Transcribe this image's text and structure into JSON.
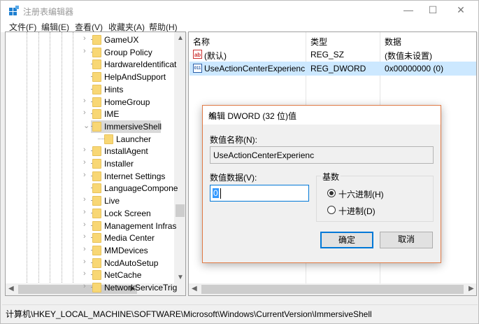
{
  "window": {
    "title": "注册表编辑器",
    "minimize": "—",
    "maximize": "☐",
    "close": "✕"
  },
  "menu": [
    "文件(F)",
    "编辑(E)",
    "查看(V)",
    "收藏夹(A)",
    "帮助(H)"
  ],
  "tree": [
    {
      "label": "GameUX",
      "expander": "›"
    },
    {
      "label": "Group Policy",
      "expander": "›"
    },
    {
      "label": "HardwareIdentificat",
      "expander": ""
    },
    {
      "label": "HelpAndSupport",
      "expander": ""
    },
    {
      "label": "Hints",
      "expander": ""
    },
    {
      "label": "HomeGroup",
      "expander": "›"
    },
    {
      "label": "IME",
      "expander": "›"
    },
    {
      "label": "ImmersiveShell",
      "expander": "⌄",
      "selected": true
    },
    {
      "label": "Launcher",
      "expander": "",
      "child": true
    },
    {
      "label": "InstallAgent",
      "expander": "›"
    },
    {
      "label": "Installer",
      "expander": "›"
    },
    {
      "label": "Internet Settings",
      "expander": "›"
    },
    {
      "label": "LanguageCompone",
      "expander": ""
    },
    {
      "label": "Live",
      "expander": "›"
    },
    {
      "label": "Lock Screen",
      "expander": "›"
    },
    {
      "label": "Management Infras",
      "expander": "›"
    },
    {
      "label": "Media Center",
      "expander": "›"
    },
    {
      "label": "MMDevices",
      "expander": "›"
    },
    {
      "label": "NcdAutoSetup",
      "expander": "›"
    },
    {
      "label": "NetCache",
      "expander": "›"
    },
    {
      "label": "NetworkServiceTrig",
      "expander": "›"
    }
  ],
  "values": {
    "headers": [
      "名称",
      "类型",
      "数据"
    ],
    "rows": [
      {
        "icon": "ab",
        "name": "(默认)",
        "type": "REG_SZ",
        "data": "(数值未设置)"
      },
      {
        "icon": "011",
        "name": "UseActionCenterExperienc",
        "type": "REG_DWORD",
        "data": "0x00000000 (0)",
        "selected": true
      }
    ]
  },
  "status": "计算机\\HKEY_LOCAL_MACHINE\\SOFTWARE\\Microsoft\\Windows\\CurrentVersion\\ImmersiveShell",
  "dialog": {
    "title": "编辑 DWORD (32 位)值",
    "close": "✕",
    "name_label": "数值名称(N):",
    "name_value": "UseActionCenterExperienc",
    "data_label": "数值数据(V):",
    "data_value": "0",
    "base_label": "基数",
    "hex": "十六进制(H)",
    "dec": "十进制(D)",
    "ok": "确定",
    "cancel": "取消"
  },
  "colors": {
    "accent": "#0078d7",
    "selection": "#cce8ff",
    "dialog_border": "#e07a45"
  }
}
